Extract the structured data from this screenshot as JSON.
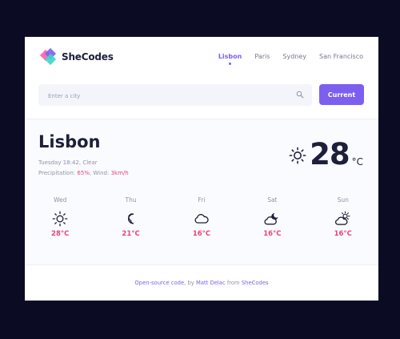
{
  "brand": {
    "name": "SheCodes",
    "logo_icon": "shecodes-logo-icon"
  },
  "nav": {
    "items": [
      {
        "label": "Lisbon",
        "active": true
      },
      {
        "label": "Paris"
      },
      {
        "label": "Sydney"
      },
      {
        "label": "San Francisco"
      }
    ]
  },
  "search": {
    "placeholder": "Enter a city",
    "value": "",
    "icon": "search-icon"
  },
  "current_button": "Current",
  "weather": {
    "city": "Lisbon",
    "datetime": "Tuesday 18:42",
    "condition": "Clear",
    "precip_label": "Precipitation:",
    "precip_value": "65%",
    "wind_label": "Wind:",
    "wind_value": "3km/h",
    "temperature": "28",
    "unit": "°C",
    "icon": "sun-icon"
  },
  "forecast": [
    {
      "day": "Wed",
      "temp": "28°C",
      "icon": "sun-icon"
    },
    {
      "day": "Thu",
      "temp": "21°C",
      "icon": "moon-icon"
    },
    {
      "day": "Fri",
      "temp": "16°C",
      "icon": "cloud-icon"
    },
    {
      "day": "Sat",
      "temp": "16°C",
      "icon": "cloudy-night-icon"
    },
    {
      "day": "Sun",
      "temp": "16°C",
      "icon": "partly-sunny-icon"
    }
  ],
  "footer": {
    "link1": "Open-source code",
    "sep1": ", by ",
    "link2": "Matt Delac",
    "sep2": " from ",
    "link3": "SheCodes"
  },
  "colors": {
    "accent": "#7d5ff0",
    "highlight": "#e8447a",
    "background": "#0b0c23",
    "text": "#1d1f3b"
  }
}
